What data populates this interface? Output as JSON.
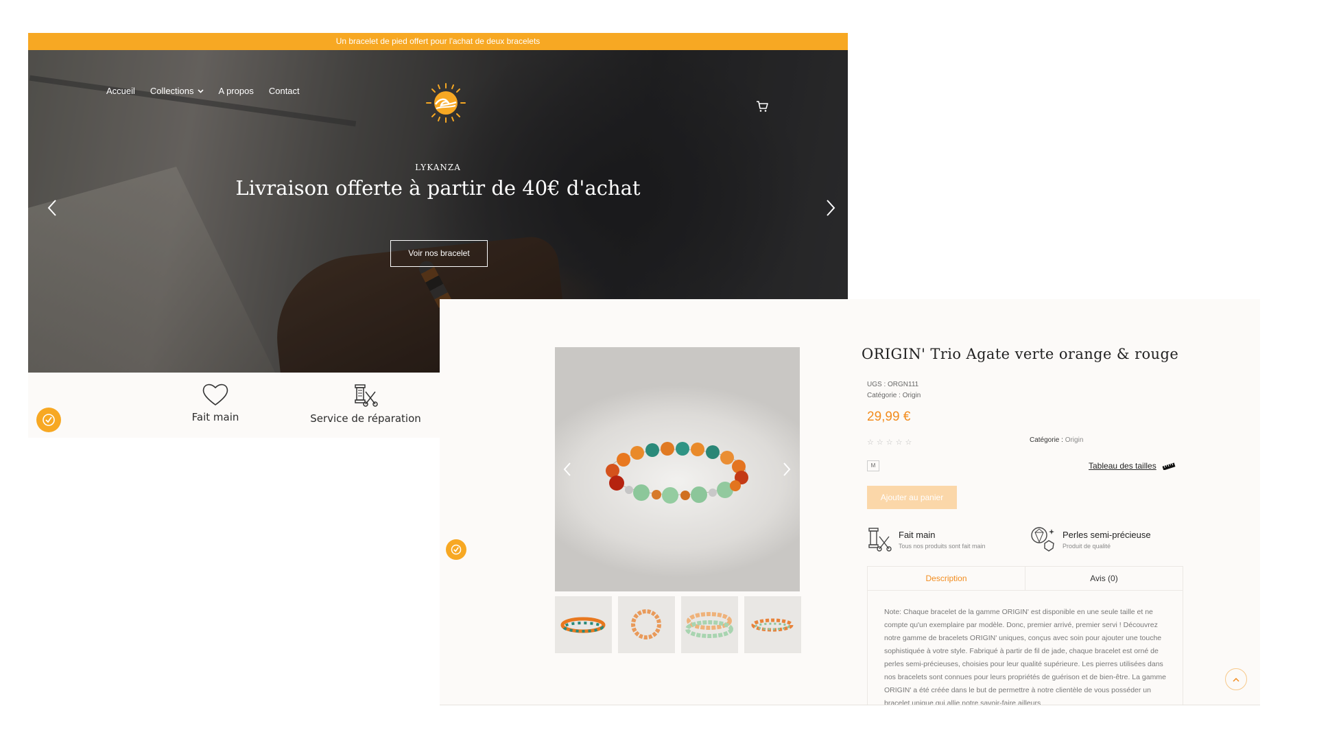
{
  "home": {
    "promo_bar": "Un bracelet de pied offert pour l'achat de deux bracelets",
    "nav": {
      "items": [
        {
          "label": "Accueil"
        },
        {
          "label": "Collections"
        },
        {
          "label": "A propos"
        },
        {
          "label": "Contact"
        }
      ]
    },
    "hero": {
      "brand": "LYKANZA",
      "title": "Livraison offerte à partir de 40€ d'achat",
      "button": "Voir nos bracelet"
    },
    "features": [
      {
        "label": "Fait main",
        "icon": "heart-icon"
      },
      {
        "label": "Service de réparation",
        "icon": "repair-icon"
      }
    ]
  },
  "product": {
    "title": "ORIGIN' Trio Agate verte orange & rouge",
    "sku": "UGS : ORGN111",
    "category_line": "Catégorie : Origin",
    "price": "29,99 €",
    "category_label": "Catégorie : ",
    "category_value": "Origin",
    "size_option": "M",
    "size_table_link": "Tableau des tailles",
    "add_to_cart": "Ajouter au panier",
    "features": [
      {
        "title": "Fait main",
        "subtitle": "Tous nos produits sont fait main",
        "icon": "sewing-icon"
      },
      {
        "title": "Perles semi-précieuse",
        "subtitle": "Produit de qualité",
        "icon": "gem-icon"
      }
    ],
    "tabs": [
      {
        "label": "Description"
      },
      {
        "label": "Avis (0)"
      }
    ],
    "description": "Note: Chaque bracelet de la gamme ORIGIN' est disponible en une seule taille et ne compte qu'un exemplaire par modèle. Donc, premier arrivé, premier servi ! Découvrez notre gamme de bracelets ORIGIN' uniques, conçus avec soin pour ajouter une touche sophistiquée à votre style. Fabriqué à partir de fil de jade, chaque bracelet est orné de perles semi-précieuses, choisies pour leur qualité supérieure. Les pierres utilisées dans nos bracelets sont connues pour leurs propriétés de guérison et de bien-être. La gamme ORIGIN' a été créée dans le but de permettre à notre clientèle de vous posséder un bracelet unique qui allie notre savoir-faire ailleurs"
  },
  "colors": {
    "accent": "#f7a823",
    "price": "#f28c1e",
    "cart_button": "#fbd7a9"
  }
}
